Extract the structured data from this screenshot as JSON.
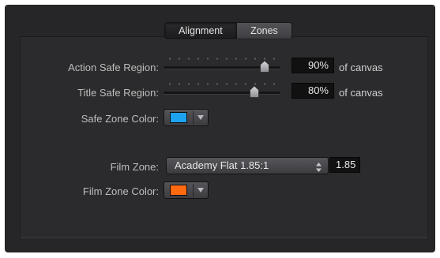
{
  "tabs": [
    {
      "label": "Alignment",
      "selected": true
    },
    {
      "label": "Zones",
      "selected": false
    }
  ],
  "action_safe": {
    "label": "Action Safe Region:",
    "value": "90%",
    "suffix": "of canvas",
    "slider_fraction": 0.9
  },
  "title_safe": {
    "label": "Title Safe Region:",
    "value": "80%",
    "suffix": "of canvas",
    "slider_fraction": 0.8
  },
  "safe_zone_color": {
    "label": "Safe Zone Color:",
    "color": "#1ea3f0"
  },
  "film_zone": {
    "label": "Film Zone:",
    "selected": "Academy Flat 1.85:1",
    "ratio": "1.85"
  },
  "film_zone_color": {
    "label": "Film Zone Color:",
    "color": "#ff6a10"
  }
}
